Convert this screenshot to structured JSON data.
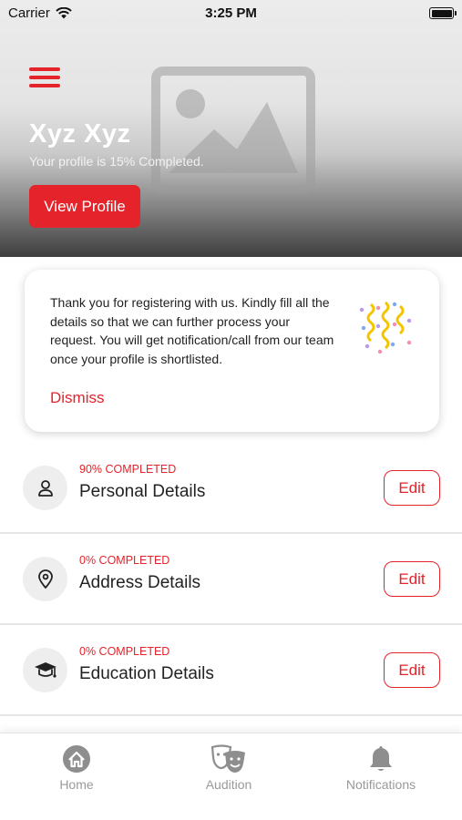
{
  "status_bar": {
    "carrier": "Carrier",
    "time": "3:25 PM"
  },
  "header": {
    "user_name": "Xyz Xyz",
    "profile_status": "Your profile is 15% Completed.",
    "view_profile_label": "View Profile"
  },
  "notice": {
    "message": "Thank you for registering with us. Kindly fill all the details so that we can further process your request. You will get notification/call from our team once your profile is shortlisted.",
    "dismiss_label": "Dismiss"
  },
  "sections": [
    {
      "progress": "90% COMPLETED",
      "title": "Personal Details",
      "edit_label": "Edit",
      "icon": "person-icon"
    },
    {
      "progress": "0% COMPLETED",
      "title": "Address Details",
      "edit_label": "Edit",
      "icon": "location-pin-icon"
    },
    {
      "progress": "0% COMPLETED",
      "title": "Education Details",
      "edit_label": "Edit",
      "icon": "graduation-cap-icon"
    }
  ],
  "tab_bar": {
    "tabs": [
      {
        "label": "Home",
        "icon": "home-icon"
      },
      {
        "label": "Audition",
        "icon": "theater-masks-icon"
      },
      {
        "label": "Notifications",
        "icon": "bell-icon"
      }
    ]
  },
  "colors": {
    "accent": "#e4232b",
    "inactive_tab": "#9a9a9a"
  }
}
